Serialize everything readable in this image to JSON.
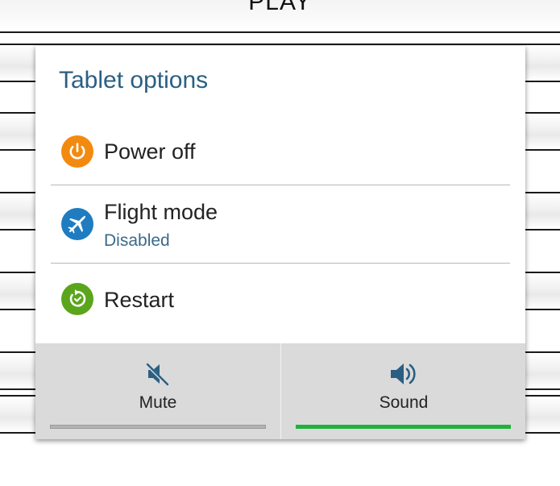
{
  "background": {
    "top_button_label": "PLAY"
  },
  "dialog": {
    "title": "Tablet options",
    "options": [
      {
        "label": "Power off",
        "icon": "power-icon",
        "icon_color": "#f28a0f"
      },
      {
        "label": "Flight mode",
        "sublabel": "Disabled",
        "icon": "airplane-off-icon",
        "icon_color": "#1f7cc1"
      },
      {
        "label": "Restart",
        "icon": "restart-icon",
        "icon_color": "#5aa51c"
      }
    ],
    "sound_modes": [
      {
        "label": "Mute",
        "icon": "mute-icon",
        "active": false
      },
      {
        "label": "Sound",
        "icon": "speaker-icon",
        "active": true
      }
    ]
  },
  "colors": {
    "title": "#2a5f83",
    "active_indicator": "#1db33a",
    "inactive_indicator": "#b3b3b3",
    "sound_icon_active": "#2a5f83",
    "sound_icon_inactive": "#2a5f83"
  }
}
